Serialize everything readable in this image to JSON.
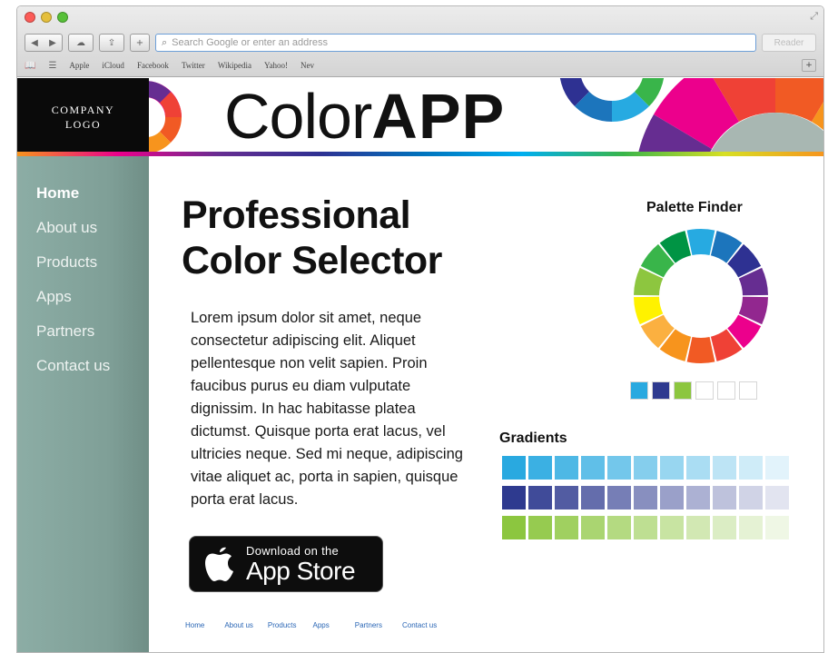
{
  "browser": {
    "address_placeholder": "Search Google or enter an address",
    "reader_label": "Reader",
    "bookmarks": [
      "Apple",
      "iCloud",
      "Facebook",
      "Twitter",
      "Wikipedia",
      "Yahoo!",
      "Nev"
    ]
  },
  "site": {
    "logo_line1": "COMPANY",
    "logo_line2": "LOGO",
    "brand_light": "Color",
    "brand_bold": "APP"
  },
  "nav": [
    {
      "label": "Home",
      "active": true
    },
    {
      "label": "About us",
      "active": false
    },
    {
      "label": "Products",
      "active": false
    },
    {
      "label": "Apps",
      "active": false
    },
    {
      "label": "Partners",
      "active": false
    },
    {
      "label": "Contact us",
      "active": false
    }
  ],
  "main": {
    "headline_line1": "Professional",
    "headline_line2": "Color Selector",
    "body": "Lorem ipsum dolor sit amet, neque consectetur adipiscing elit. Aliquet pellentesque non velit sapien. Proin faucibus purus eu diam vulputate dignissim. In hac habitasse platea dictumst. Quisque porta erat lacus, vel ultricies neque. Sed mi neque, adipiscing vitae aliquet ac, porta in sapien, quisque porta erat lacus.",
    "appstore_small": "Download on the",
    "appstore_big": "App Store"
  },
  "palette": {
    "title": "Palette Finder",
    "wheel_colors": [
      "#27aae1",
      "#1c75bc",
      "#2e3192",
      "#662d91",
      "#92278f",
      "#ec008c",
      "#ef4136",
      "#f15a24",
      "#f7941d",
      "#fbb040",
      "#fff200",
      "#8dc63f",
      "#39b54a",
      "#009444"
    ],
    "selected_swatches": [
      "#29a9e0",
      "#2e3a8f",
      "#8cc63f",
      "#ffffff",
      "#ffffff",
      "#ffffff"
    ]
  },
  "gradients": {
    "title": "Gradients",
    "base_colors": [
      "#29a9e0",
      "#2e3a8f",
      "#8cc63f"
    ],
    "steps": 11
  },
  "footer": {
    "links": [
      "Home",
      "About us",
      "Products",
      "Apps",
      "Partners",
      "Contact us"
    ]
  },
  "colors": {
    "sidebar": "#819f98",
    "link": "#2a66b5"
  }
}
